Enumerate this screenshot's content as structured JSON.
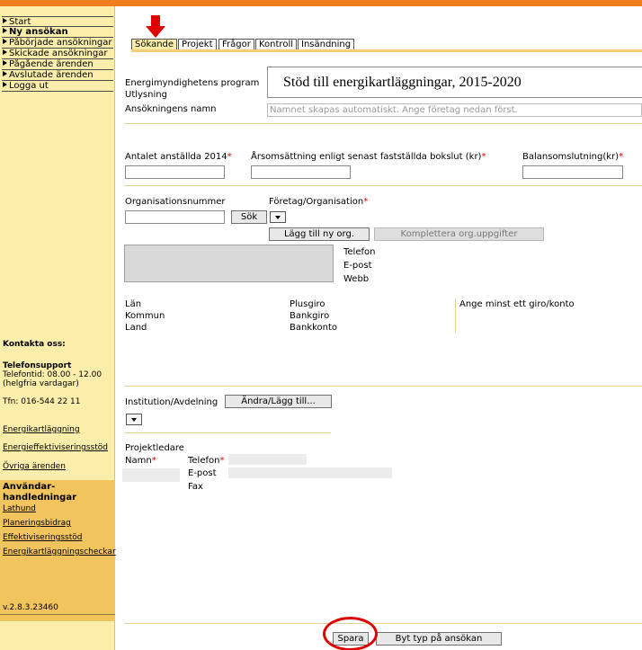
{
  "sidebar": {
    "nav": [
      {
        "label": "Start"
      },
      {
        "label": "Ny ansökan"
      },
      {
        "label": "Påbörjade ansökningar"
      },
      {
        "label": "Skickade ansökningar"
      },
      {
        "label": "Pågående ärenden"
      },
      {
        "label": "Avslutade ärenden"
      },
      {
        "label": "Logga ut"
      }
    ],
    "contact_title": "Kontakta oss:",
    "support_title": "Telefonsupport",
    "support_hours": "Telefontid: 08.00 - 12.00",
    "support_note": "(helgfria vardagar)",
    "phone": "Tfn: 016-544 22 11",
    "links": [
      "Energikartläggning",
      "Energieffektiviseringsstöd",
      "Övriga ärenden"
    ],
    "guides_title_1": "Användar-",
    "guides_title_2": "handledningar",
    "guides": [
      "Lathund",
      "Planeringsbidrag",
      "Effektiviseringsstöd",
      "Energikartläggningscheckar"
    ],
    "version": "v.2.8.3.23460"
  },
  "tabs": [
    "Sökande",
    "Projekt",
    "Frågor",
    "Kontroll",
    "Insändning"
  ],
  "form": {
    "program_label": "Energimyndighetens program",
    "utlysning_label": "Utlysning",
    "program_value": "Stöd till energikartläggningar, 2015-2020",
    "name_label": "Ansökningens namn",
    "name_placeholder": "Namnet skapas automatiskt. Ange företag nedan först.",
    "employees_label": "Antalet anställda 2014",
    "turnover_label": "Årsomsättning enligt senast fastställda bokslut (kr)",
    "balance_label": "Balansomslutning(kr)",
    "orgnr_label": "Organisationsnummer",
    "search_button": "Sök",
    "company_label": "Företag/Organisation",
    "add_org_button": "Lägg till ny org.",
    "complete_org_button": "Komplettera org.uppgifter",
    "phone_label": "Telefon",
    "email_label": "E-post",
    "web_label": "Webb",
    "lan_label": "Län",
    "kommun_label": "Kommun",
    "land_label": "Land",
    "plusgiro_label": "Plusgiro",
    "bankgiro_label": "Bankgiro",
    "bankkonto_label": "Bankkonto",
    "giro_note": "Ange minst ett giro/konto",
    "institution_label": "Institution/Avdelning",
    "change_add_button": "Ändra/Lägg till...",
    "project_leader_label": "Projektledare",
    "leader_name_label": "Namn",
    "leader_phone_label": "Telefon",
    "leader_email_label": "E-post",
    "leader_fax_label": "Fax",
    "required_mark": "*"
  },
  "footer": {
    "save_button": "Spara",
    "change_type_button": "Byt typ på ansökan"
  },
  "colors": {
    "top_bar": "#f07e1c",
    "sidebar": "#fbeeaa",
    "guides": "#f2c45e",
    "highlight": "#e00000"
  }
}
